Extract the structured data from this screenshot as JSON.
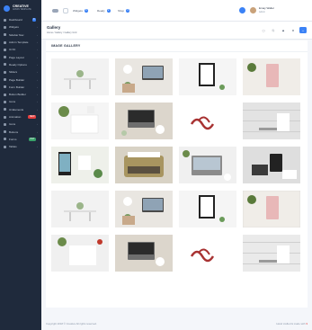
{
  "brand": {
    "name": "CREATIVE",
    "tagline": "ADMIN TEMPLATE"
  },
  "sidebar": {
    "items": [
      {
        "label": "Dashboard",
        "badge": "8",
        "badge_color": "#3b82f6"
      },
      {
        "label": "Widgets",
        "badge": "",
        "badge_color": ""
      },
      {
        "label": "Sidebar Nav",
        "badge": "",
        "badge_color": ""
      },
      {
        "label": "Admin Template",
        "badge": "",
        "badge_color": ""
      },
      {
        "label": "Ui Kit",
        "badge": "",
        "badge_color": ""
      },
      {
        "label": "Page Layout",
        "badge": "",
        "badge_color": ""
      },
      {
        "label": "Ready Options",
        "badge": "",
        "badge_color": ""
      },
      {
        "label": "Sliders",
        "badge": "",
        "badge_color": ""
      },
      {
        "label": "Page Builder",
        "badge": "",
        "badge_color": ""
      },
      {
        "label": "Form Builder",
        "badge": "",
        "badge_color": ""
      },
      {
        "label": "Button Builder",
        "badge": "",
        "badge_color": ""
      },
      {
        "label": "Icons",
        "badge": "",
        "badge_color": ""
      },
      {
        "label": "Ui Elements",
        "badge": "",
        "badge_color": ""
      },
      {
        "label": "Animation",
        "badge": "NEW",
        "badge_color": "#e53e3e"
      },
      {
        "label": "Icons",
        "badge": "",
        "badge_color": ""
      },
      {
        "label": "Buttons",
        "badge": "",
        "badge_color": ""
      },
      {
        "label": "Forms",
        "badge": "HOT",
        "badge_color": "#38a169"
      },
      {
        "label": "Tables",
        "badge": "",
        "badge_color": ""
      }
    ]
  },
  "topbar": {
    "menus": [
      {
        "label": "Widgets",
        "count": "8"
      },
      {
        "label": "Ready",
        "count": "2"
      },
      {
        "label": "Shop",
        "count": "3"
      }
    ],
    "user": {
      "name": "Emay Walter",
      "role": "Admin"
    }
  },
  "header": {
    "title": "Gallery",
    "breadcrumb": "Home  /  Gallery  /  Gallery Grid"
  },
  "gallery": {
    "title": "IMAGE GALLERY"
  },
  "footer": {
    "copyright": "Copyright 2018 © Creative All rights reserved.",
    "credit": "Hand crafted & made with"
  },
  "colors": {
    "accent": "#3b82f6",
    "sidebar": "#1f2a3c"
  }
}
